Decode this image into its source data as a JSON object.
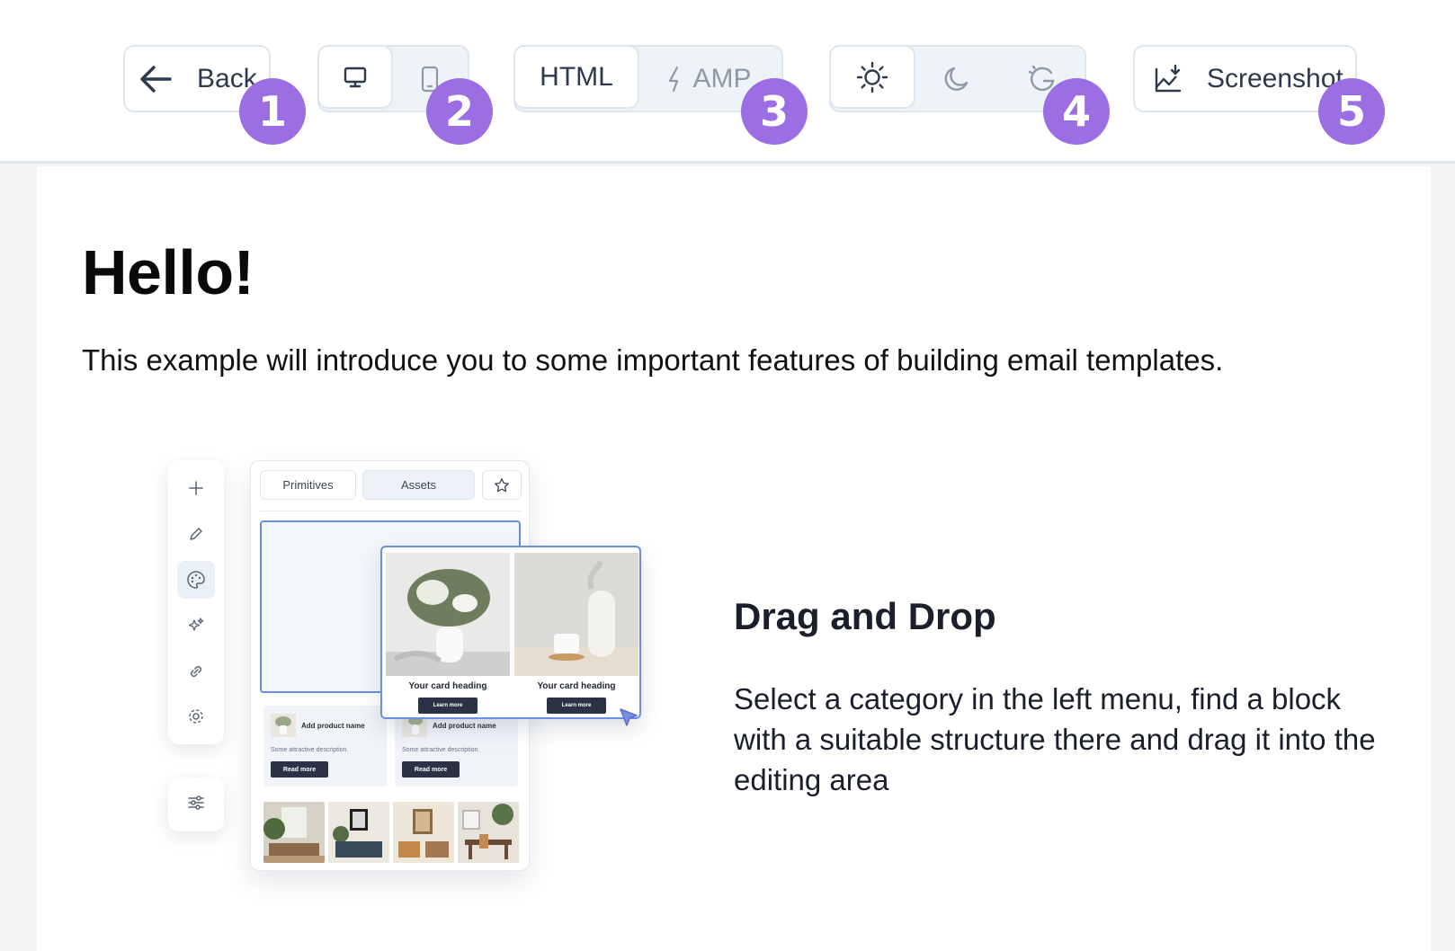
{
  "toolbar": {
    "back_label": "Back",
    "html_label": "HTML",
    "amp_label": "AMP",
    "screenshot_label": "Screenshot",
    "badges": [
      "1",
      "2",
      "3",
      "4",
      "5"
    ],
    "accent_color": "#9b6ee3",
    "icons": {
      "back": "arrow-left-icon",
      "desktop": "desktop-icon",
      "mobile": "mobile-icon",
      "amp": "lightning-icon",
      "light": "sun-icon",
      "dark": "moon-icon",
      "auto": "auto-theme-icon",
      "screenshot": "image-download-icon"
    }
  },
  "content": {
    "heading": "Hello!",
    "intro": "This example will introduce you to some important features of building email templates.",
    "feature_title": "Drag and Drop",
    "feature_text": "Select a category in the left menu, find a block with a suitable structure there and drag it into the editing area"
  },
  "illustration": {
    "tabs": [
      "Primitives",
      "Assets"
    ],
    "rail_icons": [
      "plus-icon",
      "pencil-icon",
      "palette-icon",
      "sparkles-icon",
      "link-icon",
      "settings-icon"
    ],
    "products": [
      {
        "name": "Add product name",
        "desc": "Some attractive description.",
        "button": "Read more"
      },
      {
        "name": "Add product name",
        "desc": "Some attractive description.",
        "button": "Read more"
      }
    ],
    "cards": [
      {
        "heading": "Your card heading",
        "button": "Learn more"
      },
      {
        "heading": "Your card heading",
        "button": "Learn more"
      }
    ]
  }
}
